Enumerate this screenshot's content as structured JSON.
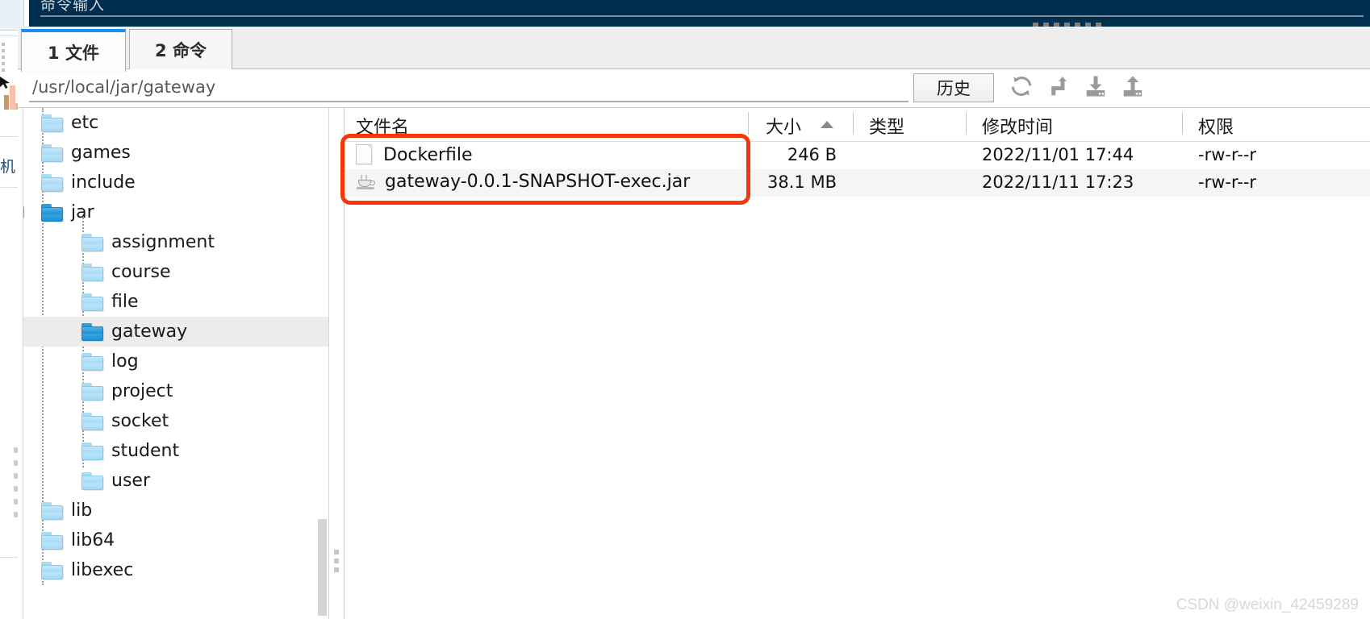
{
  "window": {
    "header_title": "命令输入"
  },
  "tabs": [
    {
      "label": "1 文件",
      "active": true
    },
    {
      "label": "2 命令",
      "active": false
    }
  ],
  "path_bar": {
    "value": "/usr/local/jar/gateway",
    "placeholder": "/usr/local/jar/gateway",
    "history_label": "历史",
    "icons": [
      {
        "name": "refresh-icon",
        "title": "刷新"
      },
      {
        "name": "up-level-icon",
        "title": "上级目录"
      },
      {
        "name": "download-icon",
        "title": "下载"
      },
      {
        "name": "upload-icon",
        "title": "上传"
      }
    ]
  },
  "tree": {
    "nodes": [
      {
        "label": "etc",
        "depth": 1,
        "type": "folder",
        "state": "closed",
        "selected": false
      },
      {
        "label": "games",
        "depth": 1,
        "type": "folder",
        "state": "closed",
        "selected": false
      },
      {
        "label": "include",
        "depth": 1,
        "type": "folder",
        "state": "closed",
        "selected": false
      },
      {
        "label": "jar",
        "depth": 1,
        "type": "folder",
        "state": "expanded",
        "selected": false
      },
      {
        "label": "assignment",
        "depth": 2,
        "type": "folder",
        "state": "closed",
        "selected": false
      },
      {
        "label": "course",
        "depth": 2,
        "type": "folder",
        "state": "closed",
        "selected": false
      },
      {
        "label": "file",
        "depth": 2,
        "type": "folder",
        "state": "closed",
        "selected": false
      },
      {
        "label": "gateway",
        "depth": 2,
        "type": "folder",
        "state": "open",
        "selected": true
      },
      {
        "label": "log",
        "depth": 2,
        "type": "folder",
        "state": "closed",
        "selected": false
      },
      {
        "label": "project",
        "depth": 2,
        "type": "folder",
        "state": "closed",
        "selected": false
      },
      {
        "label": "socket",
        "depth": 2,
        "type": "folder",
        "state": "closed",
        "selected": false
      },
      {
        "label": "student",
        "depth": 2,
        "type": "folder",
        "state": "closed",
        "selected": false
      },
      {
        "label": "user",
        "depth": 2,
        "type": "folder",
        "state": "closed",
        "selected": false
      },
      {
        "label": "lib",
        "depth": 1,
        "type": "folder",
        "state": "closed",
        "selected": false
      },
      {
        "label": "lib64",
        "depth": 1,
        "type": "folder",
        "state": "closed",
        "selected": false
      },
      {
        "label": "libexec",
        "depth": 1,
        "type": "folder",
        "state": "closed",
        "selected": false
      }
    ]
  },
  "file_list": {
    "columns": [
      {
        "key": "name",
        "label": "文件名",
        "sort": null
      },
      {
        "key": "size",
        "label": "大小",
        "sort": "asc"
      },
      {
        "key": "type",
        "label": "类型",
        "sort": null
      },
      {
        "key": "modified",
        "label": "修改时间",
        "sort": null
      },
      {
        "key": "perm",
        "label": "权限",
        "sort": null
      }
    ],
    "rows": [
      {
        "icon": "document-icon",
        "name": "Dockerfile",
        "size": "246 B",
        "type": "",
        "modified": "2022/11/01 17:44",
        "perm": "-rw-r--r",
        "selected": false
      },
      {
        "icon": "jar-icon",
        "name": "gateway-0.0.1-SNAPSHOT-exec.jar",
        "size": "38.1 MB",
        "type": "",
        "modified": "2022/11/11 17:23",
        "perm": "-rw-r--r",
        "selected": true
      }
    ]
  },
  "annotation": {
    "color": "#f6360a",
    "shape": "rounded-rectangle"
  },
  "watermark": {
    "text": "CSDN @weixin_42459289"
  },
  "left_strip": {
    "label": "机"
  }
}
